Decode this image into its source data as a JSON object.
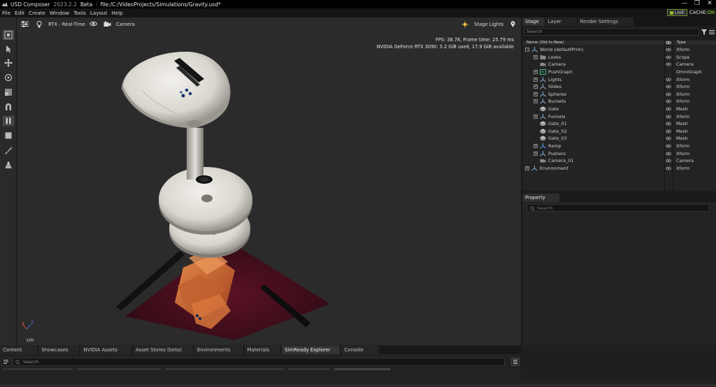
{
  "app": {
    "name": "USD Composer",
    "version": "2023.2.2",
    "channel": "Beta",
    "file": "file:/C:/VideoProjects/Simulations/Gravity.usd*"
  },
  "menu": [
    "File",
    "Edit",
    "Create",
    "Window",
    "Tools",
    "Layout",
    "Help"
  ],
  "status": {
    "live_label": "LIVE",
    "cache_label": "CACHE:",
    "cache_state": "ON"
  },
  "window_controls": {
    "minimize": "—",
    "maximize": "❐",
    "close": "✕"
  },
  "left_tools": [
    {
      "icon": "frame-select-icon"
    },
    {
      "icon": "select-arrow-icon"
    },
    {
      "icon": "move-icon"
    },
    {
      "icon": "rotate-icon"
    },
    {
      "icon": "scale-icon"
    },
    {
      "icon": "snap-icon"
    },
    {
      "icon": "pause-icon"
    },
    {
      "icon": "stop-icon"
    },
    {
      "icon": "paint-icon"
    },
    {
      "icon": "lighting-icon"
    }
  ],
  "viewport": {
    "render_mode": "RTX - Real-Time",
    "camera": "Camera",
    "stage_lights": "Stage Lights",
    "fps_line": "FPS: 38.78, Frame time: 25.79 ms",
    "gpu_line": "NVIDIA GeForce RTX 3090: 5.2 GiB used, 17.9 GiB available",
    "unit": "cm",
    "axis_x": "X",
    "axis_z": "Z"
  },
  "stage": {
    "tabs": [
      "Stage",
      "Layer",
      "Render Settings"
    ],
    "search_placeholder": "Search",
    "columns": {
      "name": "Name (Old to New)",
      "type": "Type"
    },
    "rows": [
      {
        "name": "World (defaultPrim)",
        "type": "Xform",
        "indent": 0,
        "expander": "minus",
        "icon": "xform",
        "visible": true
      },
      {
        "name": "Looks",
        "type": "Scope",
        "indent": 1,
        "expander": "plus",
        "icon": "folder",
        "visible": true
      },
      {
        "name": "Camera",
        "type": "Camera",
        "indent": 1,
        "expander": "none",
        "icon": "camera",
        "visible": true
      },
      {
        "name": "PushGraph",
        "type": "OmniGraph",
        "indent": 1,
        "expander": "plus",
        "icon": "graph",
        "visible": false
      },
      {
        "name": "Lights",
        "type": "Xform",
        "indent": 1,
        "expander": "plus",
        "icon": "xform",
        "visible": true
      },
      {
        "name": "Slides",
        "type": "Xform",
        "indent": 1,
        "expander": "plus",
        "icon": "xform",
        "visible": true
      },
      {
        "name": "Spheres",
        "type": "Xform",
        "indent": 1,
        "expander": "plus",
        "icon": "xform",
        "visible": true
      },
      {
        "name": "Buckets",
        "type": "Xform",
        "indent": 1,
        "expander": "plus",
        "icon": "xform",
        "visible": true
      },
      {
        "name": "Gate",
        "type": "Mesh",
        "indent": 1,
        "expander": "none",
        "icon": "mesh",
        "visible": true
      },
      {
        "name": "Funnels",
        "type": "Xform",
        "indent": 1,
        "expander": "plus",
        "icon": "xform",
        "visible": true
      },
      {
        "name": "Gate_01",
        "type": "Mesh",
        "indent": 1,
        "expander": "none",
        "icon": "mesh",
        "visible": true
      },
      {
        "name": "Gate_02",
        "type": "Mesh",
        "indent": 1,
        "expander": "none",
        "icon": "mesh",
        "visible": true
      },
      {
        "name": "Gate_03",
        "type": "Mesh",
        "indent": 1,
        "expander": "none",
        "icon": "mesh",
        "visible": true
      },
      {
        "name": "Ramp",
        "type": "Xform",
        "indent": 1,
        "expander": "plus",
        "icon": "xform-blue",
        "visible": true
      },
      {
        "name": "Pushers",
        "type": "Xform",
        "indent": 1,
        "expander": "plus",
        "icon": "xform",
        "visible": true
      },
      {
        "name": "Camera_01",
        "type": "Camera",
        "indent": 1,
        "expander": "none",
        "icon": "camera",
        "visible": true
      },
      {
        "name": "Environment",
        "type": "Xform",
        "indent": 0,
        "expander": "plus",
        "icon": "xform",
        "visible": true
      }
    ]
  },
  "property": {
    "tab": "Property",
    "search_placeholder": "Search"
  },
  "bottom": {
    "tabs": [
      "Content",
      "Showcases",
      "NVIDIA Assets",
      "Asset Stores (beta)",
      "Environments",
      "Materials",
      "SimReady Explorer",
      "Console"
    ],
    "active_tab": "SimReady Explorer",
    "search_placeholder": "Search"
  },
  "colors": {
    "accent_live": "#8fbf2f",
    "cache_on": "#8fd02f",
    "xform_icon": "#7aa0c8",
    "graph_icon": "#3fb58a"
  }
}
